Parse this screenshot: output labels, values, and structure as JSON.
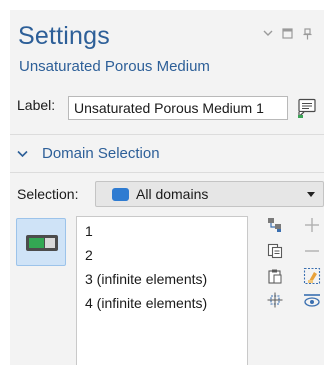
{
  "header": {
    "title": "Settings",
    "subtitle": "Unsaturated Porous Medium"
  },
  "label_field": {
    "label": "Label:",
    "value": "Unsaturated Porous Medium 1"
  },
  "domain_selection": {
    "heading": "Domain Selection",
    "selection_label": "Selection:",
    "selection_value": "All domains",
    "items": [
      "1",
      "2",
      "3 (infinite elements)",
      "4 (infinite elements)"
    ]
  },
  "colors": {
    "accent": "#2d5f98",
    "selection_swatch": "#2e7bd1",
    "active_button_bg": "#cfe3f7"
  }
}
